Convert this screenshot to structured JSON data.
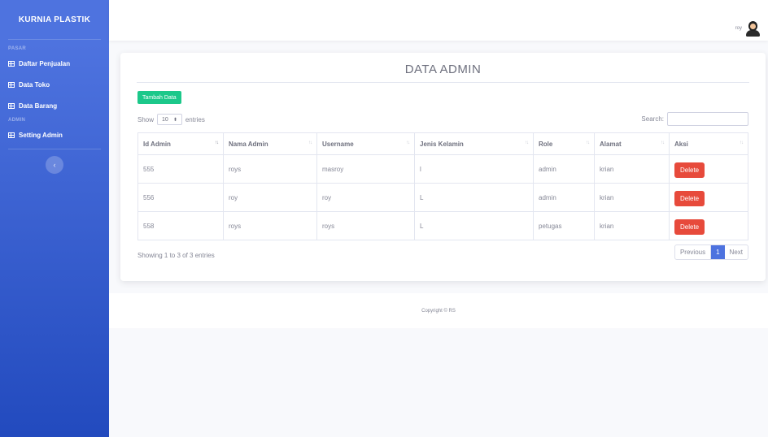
{
  "sidebar": {
    "brand": "KURNIA PLASTIK",
    "heading_pasar": "PASAR",
    "items": [
      {
        "label": "Daftar Penjualan"
      },
      {
        "label": "Data Toko"
      },
      {
        "label": "Data Barang"
      }
    ],
    "heading_admin": "ADMIN",
    "admin_item": {
      "label": "Setting Admin"
    },
    "toggle_glyph": "‹"
  },
  "topbar": {
    "user_name": "roy"
  },
  "card": {
    "title": "DATA ADMIN",
    "add_button": "Tambah Data",
    "show_label": "Show",
    "entries_value": "10",
    "entries_label": "entries",
    "search_label": "Search:",
    "search_value": ""
  },
  "table": {
    "headers": [
      "Id Admin",
      "Nama Admin",
      "Username",
      "Jenis Kelamin",
      "Role",
      "Alamat",
      "Aksi"
    ],
    "rows": [
      {
        "id": "555",
        "nama": "roys",
        "username": "masroy",
        "jk": "l",
        "role": "admin",
        "alamat": "krian",
        "aksi": "Delete"
      },
      {
        "id": "556",
        "nama": "roy",
        "username": "roy",
        "jk": "L",
        "role": "admin",
        "alamat": "krian",
        "aksi": "Delete"
      },
      {
        "id": "558",
        "nama": "roys",
        "username": "roys",
        "jk": "L",
        "role": "petugas",
        "alamat": "krian",
        "aksi": "Delete"
      }
    ]
  },
  "pagination": {
    "info": "Showing 1 to 3 of 3 entries",
    "previous": "Previous",
    "current": "1",
    "next": "Next"
  },
  "footer": {
    "copyright": "Copyright © RS"
  },
  "colors": {
    "primary": "#4e73df",
    "success": "#1cc88a",
    "danger": "#e74a3b"
  }
}
